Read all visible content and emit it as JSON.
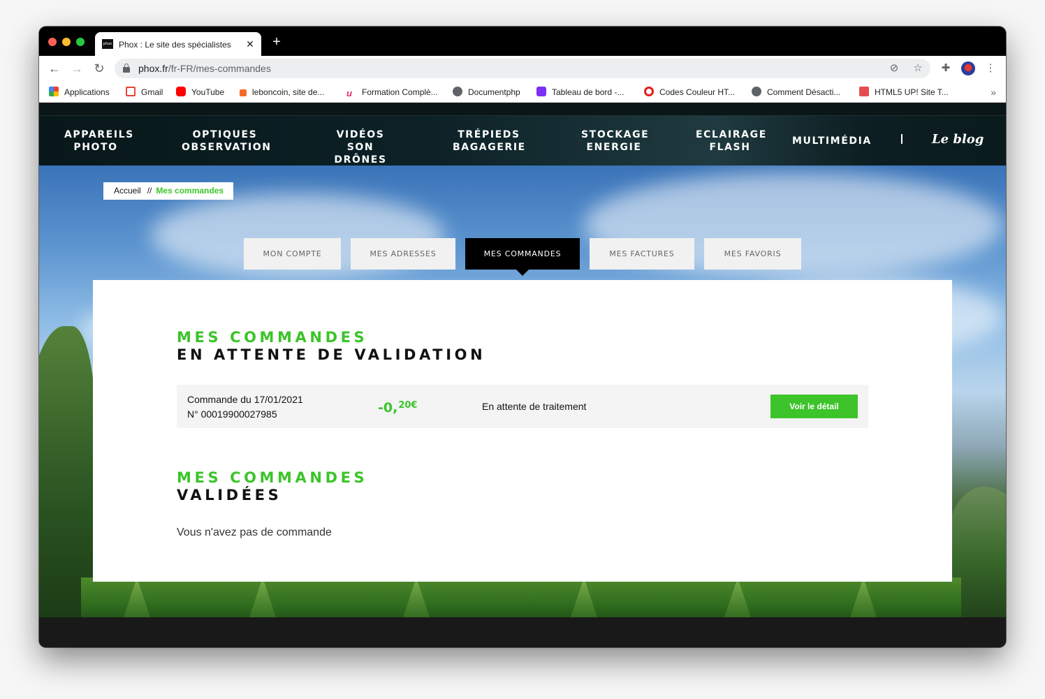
{
  "browser": {
    "tab_title": "Phox : Le site des spécialistes",
    "tab_favicon_text": "phox",
    "url_host": "phox.fr",
    "url_path": "/fr-FR/mes-commandes",
    "bookmarks": [
      {
        "label": "Applications",
        "icon": "apps-grid-icon",
        "color": "#4285f4"
      },
      {
        "label": "Gmail",
        "icon": "gmail-icon",
        "color": "#ea4335"
      },
      {
        "label": "YouTube",
        "icon": "youtube-icon",
        "color": "#ff0000"
      },
      {
        "label": "leboncoin, site de...",
        "icon": "leboncoin-icon",
        "color": "#f56b2a"
      },
      {
        "label": "Formation Complè...",
        "icon": "formation-icon",
        "color": "#e0245e"
      },
      {
        "label": "Documentphp",
        "icon": "globe-icon",
        "color": "#5f6368"
      },
      {
        "label": "Tableau de bord -...",
        "icon": "dashboard-icon",
        "color": "#7b2ff7"
      },
      {
        "label": "Codes Couleur HT...",
        "icon": "codes-couleur-icon",
        "color": "#e21b1b"
      },
      {
        "label": "Comment Désacti...",
        "icon": "globe-icon",
        "color": "#5f6368"
      },
      {
        "label": "HTML5 UP! Site T...",
        "icon": "html5up-icon",
        "color": "#e44d4d"
      }
    ]
  },
  "nav": {
    "items": [
      "APPAREILS\nPHOTO",
      "OPTIQUES\nOBSERVATION",
      "VIDÉOS SON\nDRÔNES",
      "TRÉPIEDS\nBAGAGERIE",
      "STOCKAGE\nENERGIE",
      "ECLAIRAGE\nFLASH",
      "MULTIMÉDIA"
    ],
    "blog_label": "Le blog"
  },
  "breadcrumb": {
    "home": "Accueil",
    "separator": "//",
    "current": "Mes commandes"
  },
  "account_tabs": [
    {
      "label": "MON COMPTE",
      "active": false
    },
    {
      "label": "MES ADRESSES",
      "active": false
    },
    {
      "label": "MES COMMANDES",
      "active": true
    },
    {
      "label": "MES FACTURES",
      "active": false
    },
    {
      "label": "MES FAVORIS",
      "active": false
    }
  ],
  "pending": {
    "title_line1": "MES COMMANDES",
    "title_line2": "EN ATTENTE DE VALIDATION",
    "order": {
      "date_label": "Commande du 17/01/2021",
      "number_label": "N° 00019900027985",
      "price_int": "-0,",
      "price_dec": "20€",
      "status": "En attente de traitement",
      "button_label": "Voir le détail"
    }
  },
  "validated": {
    "title_line1": "MES COMMANDES",
    "title_line2": "VALIDÉES",
    "empty_message": "Vous n'avez pas de commande"
  },
  "colors": {
    "accent_green": "#3cc42a",
    "nav_bg": "#0c2126",
    "active_tab": "#000000"
  }
}
